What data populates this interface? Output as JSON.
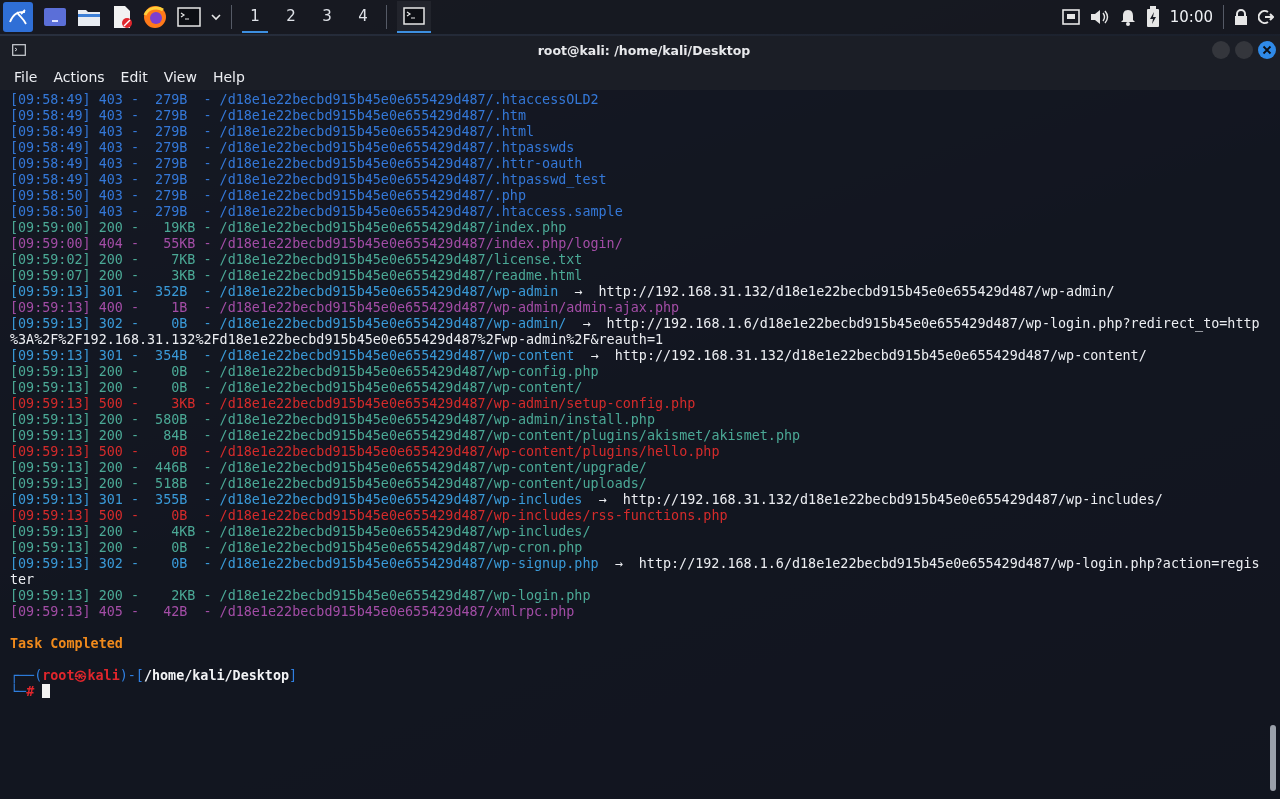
{
  "taskbar": {
    "launchers": [
      {
        "kind": "kali"
      },
      {
        "kind": "desktop"
      },
      {
        "kind": "folder"
      },
      {
        "kind": "editor"
      },
      {
        "kind": "browser"
      },
      {
        "kind": "terminal"
      },
      {
        "kind": "caret"
      }
    ],
    "workspaces": [
      {
        "label": "1",
        "selected": true
      },
      {
        "label": "2",
        "selected": false
      },
      {
        "label": "3",
        "selected": false
      },
      {
        "label": "4",
        "selected": false
      }
    ],
    "tasks": [
      {
        "kind": "terminal",
        "selected": true
      }
    ],
    "tray": [
      {
        "kind": "network"
      },
      {
        "kind": "volume"
      },
      {
        "kind": "bell"
      },
      {
        "kind": "battery"
      }
    ],
    "clock": "10:00",
    "session": [
      {
        "kind": "lock"
      },
      {
        "kind": "logout"
      }
    ]
  },
  "window": {
    "title": "root@kali: /home/kali/Desktop",
    "menu": [
      "File",
      "Actions",
      "Edit",
      "View",
      "Help"
    ]
  },
  "terminal": {
    "lines": [
      {
        "kind": "forbidden",
        "text": "[09:58:49] 403 -  279B  - /d18e1e22becbd915b45e0e655429d487/.htaccessOLD2"
      },
      {
        "kind": "forbidden",
        "text": "[09:58:49] 403 -  279B  - /d18e1e22becbd915b45e0e655429d487/.htm"
      },
      {
        "kind": "forbidden",
        "text": "[09:58:49] 403 -  279B  - /d18e1e22becbd915b45e0e655429d487/.html"
      },
      {
        "kind": "forbidden",
        "text": "[09:58:49] 403 -  279B  - /d18e1e22becbd915b45e0e655429d487/.htpasswds"
      },
      {
        "kind": "forbidden",
        "text": "[09:58:49] 403 -  279B  - /d18e1e22becbd915b45e0e655429d487/.httr-oauth"
      },
      {
        "kind": "forbidden",
        "text": "[09:58:49] 403 -  279B  - /d18e1e22becbd915b45e0e655429d487/.htpasswd_test"
      },
      {
        "kind": "forbidden",
        "text": "[09:58:50] 403 -  279B  - /d18e1e22becbd915b45e0e655429d487/.php"
      },
      {
        "kind": "forbidden",
        "text": "[09:58:50] 403 -  279B  - /d18e1e22becbd915b45e0e655429d487/.htaccess.sample"
      },
      {
        "kind": "success",
        "text": "[09:59:00] 200 -   19KB - /d18e1e22becbd915b45e0e655429d487/index.php"
      },
      {
        "kind": "client-error",
        "text": "[09:59:00] 404 -   55KB - /d18e1e22becbd915b45e0e655429d487/index.php/login/"
      },
      {
        "kind": "success",
        "text": "[09:59:02] 200 -    7KB - /d18e1e22becbd915b45e0e655429d487/license.txt"
      },
      {
        "kind": "success",
        "text": "[09:59:07] 200 -    3KB - /d18e1e22becbd915b45e0e655429d487/readme.html"
      },
      {
        "kind": "redirect",
        "text": "[09:59:13] 301 -  352B  - /d18e1e22becbd915b45e0e655429d487/wp-admin",
        "target": "→  http://192.168.31.132/d18e1e22becbd915b45e0e655429d487/wp-admin/"
      },
      {
        "kind": "client-error",
        "text": "[09:59:13] 400 -    1B  - /d18e1e22becbd915b45e0e655429d487/wp-admin/admin-ajax.php"
      },
      {
        "kind": "redirect",
        "text": "[09:59:13] 302 -    0B  - /d18e1e22becbd915b45e0e655429d487/wp-admin/",
        "target": "→  http://192.168.1.6/d18e1e22becbd915b45e0e655429d487/wp-login.php?redirect_to=http"
      },
      {
        "kind": "wrap",
        "text": "%3A%2F%2F192.168.31.132%2Fd18e1e22becbd915b45e0e655429d487%2Fwp-admin%2F&reauth=1"
      },
      {
        "kind": "redirect",
        "text": "[09:59:13] 301 -  354B  - /d18e1e22becbd915b45e0e655429d487/wp-content",
        "target": "→  http://192.168.31.132/d18e1e22becbd915b45e0e655429d487/wp-content/"
      },
      {
        "kind": "success",
        "text": "[09:59:13] 200 -    0B  - /d18e1e22becbd915b45e0e655429d487/wp-config.php"
      },
      {
        "kind": "success",
        "text": "[09:59:13] 200 -    0B  - /d18e1e22becbd915b45e0e655429d487/wp-content/"
      },
      {
        "kind": "server-error",
        "text": "[09:59:13] 500 -    3KB - /d18e1e22becbd915b45e0e655429d487/wp-admin/setup-config.php"
      },
      {
        "kind": "success",
        "text": "[09:59:13] 200 -  580B  - /d18e1e22becbd915b45e0e655429d487/wp-admin/install.php"
      },
      {
        "kind": "success",
        "text": "[09:59:13] 200 -   84B  - /d18e1e22becbd915b45e0e655429d487/wp-content/plugins/akismet/akismet.php"
      },
      {
        "kind": "server-error",
        "text": "[09:59:13] 500 -    0B  - /d18e1e22becbd915b45e0e655429d487/wp-content/plugins/hello.php"
      },
      {
        "kind": "success",
        "text": "[09:59:13] 200 -  446B  - /d18e1e22becbd915b45e0e655429d487/wp-content/upgrade/"
      },
      {
        "kind": "success",
        "text": "[09:59:13] 200 -  518B  - /d18e1e22becbd915b45e0e655429d487/wp-content/uploads/"
      },
      {
        "kind": "redirect",
        "text": "[09:59:13] 301 -  355B  - /d18e1e22becbd915b45e0e655429d487/wp-includes",
        "target": "→  http://192.168.31.132/d18e1e22becbd915b45e0e655429d487/wp-includes/"
      },
      {
        "kind": "server-error",
        "text": "[09:59:13] 500 -    0B  - /d18e1e22becbd915b45e0e655429d487/wp-includes/rss-functions.php"
      },
      {
        "kind": "success",
        "text": "[09:59:13] 200 -    4KB - /d18e1e22becbd915b45e0e655429d487/wp-includes/"
      },
      {
        "kind": "success",
        "text": "[09:59:13] 200 -    0B  - /d18e1e22becbd915b45e0e655429d487/wp-cron.php"
      },
      {
        "kind": "redirect",
        "text": "[09:59:13] 302 -    0B  - /d18e1e22becbd915b45e0e655429d487/wp-signup.php",
        "target": "→  http://192.168.1.6/d18e1e22becbd915b45e0e655429d487/wp-login.php?action=regis"
      },
      {
        "kind": "wrap",
        "text": "ter"
      },
      {
        "kind": "success",
        "text": "[09:59:13] 200 -    2KB - /d18e1e22becbd915b45e0e655429d487/wp-login.php"
      },
      {
        "kind": "client-error",
        "text": "[09:59:13] 405 -   42B  - /d18e1e22becbd915b45e0e655429d487/xmlrpc.php"
      },
      {
        "kind": "status",
        "text": "Task Completed"
      }
    ],
    "prompt": {
      "open": "┌──(",
      "user": "root㉿kali",
      "mid": ")-[",
      "path": "/home/kali/Desktop",
      "close": "]",
      "corner": "└─",
      "symbol": "#"
    }
  }
}
